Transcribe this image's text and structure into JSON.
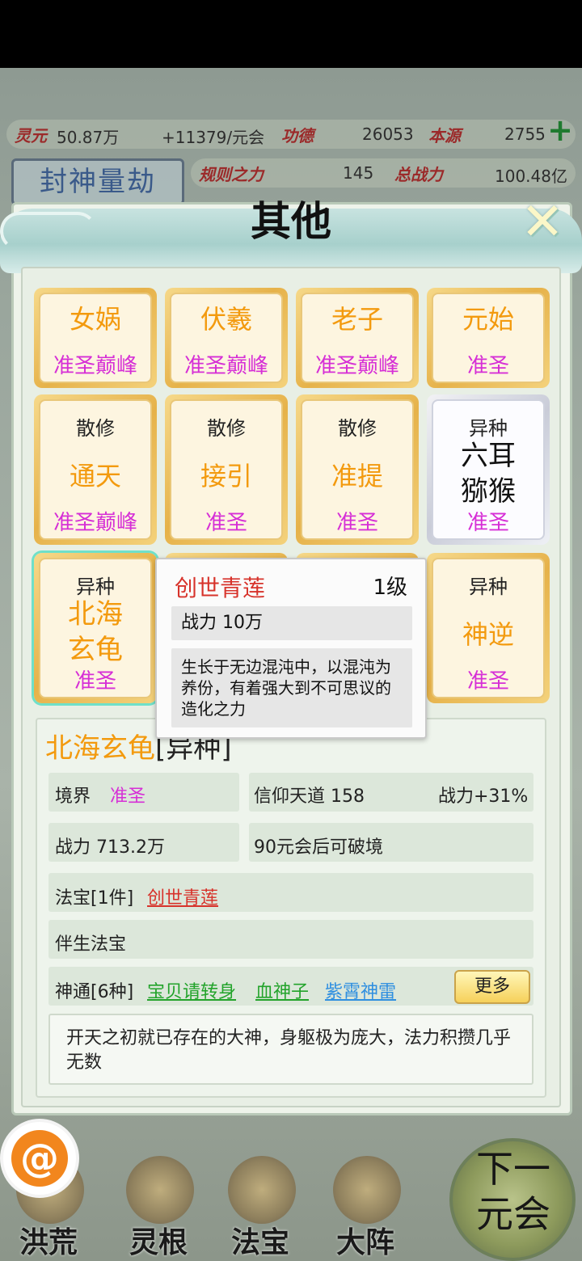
{
  "resources": {
    "lingyuan_label": "灵元",
    "lingyuan_value": "50.87万",
    "lingyuan_rate": "+11379/元会",
    "gongde_label": "功德",
    "gongde_value": "26053",
    "benyuan_label": "本源",
    "benyuan_value": "2755",
    "guize_label": "规则之力",
    "guize_value": "145",
    "zongzhanli_label": "总战力",
    "zongzhanli_value": "100.48亿",
    "event_label": "封神量劫"
  },
  "dialog": {
    "title": "其他",
    "close_symbol": "✕"
  },
  "cards": [
    {
      "type": "",
      "name": "女娲",
      "rank": "准圣巅峰"
    },
    {
      "type": "",
      "name": "伏羲",
      "rank": "准圣巅峰"
    },
    {
      "type": "",
      "name": "老子",
      "rank": "准圣巅峰"
    },
    {
      "type": "",
      "name": "元始",
      "rank": "准圣"
    },
    {
      "type": "散修",
      "name": "通天",
      "rank": "准圣巅峰"
    },
    {
      "type": "散修",
      "name": "接引",
      "rank": "准圣"
    },
    {
      "type": "散修",
      "name": "准提",
      "rank": "准圣"
    },
    {
      "type": "异种",
      "name_line1": "六耳",
      "name_line2": "猕猴",
      "rank": "准圣"
    },
    {
      "type": "异种",
      "name_line1": "北海",
      "name_line2": "玄龟",
      "rank": "准圣"
    },
    {
      "type": "异种",
      "name": "神逆",
      "rank": "准圣"
    }
  ],
  "tooltip": {
    "name": "创世青莲",
    "level": "1级",
    "power": "战力  10万",
    "description": "生长于无边混沌中，以混沌为养份，有着强大到不可思议的造化之力"
  },
  "detail": {
    "name": "北海玄龟",
    "type_suffix": "[异种]",
    "realm_label": "境界",
    "realm_value": "准圣",
    "faith": "信仰天道  158",
    "power_bonus": "战力+31%",
    "power": "战力 713.2万",
    "breakthrough": "90元会后可破境",
    "treasure_label": "法宝[1件]",
    "treasure_item": "创世青莲",
    "companion_label": "伴生法宝",
    "skills_label": "神通[6种]",
    "skill_1": "宝贝请转身",
    "skill_2": "血神子",
    "skill_3": "紫霄神雷",
    "more_button": "更多",
    "description": "开天之初就已存在的大神，身躯极为庞大，法力积攒几乎无数"
  },
  "nav": {
    "items": [
      "洪荒",
      "灵根",
      "法宝",
      "大阵"
    ],
    "next_line1": "下一",
    "next_line2": "元会"
  },
  "colors": {
    "accent_gold": "#f39a0e",
    "rank_pink": "#d62fd6",
    "treasure_red": "#d7332b",
    "skill_green": "#22a32a",
    "skill_blue": "#2f8fe0"
  }
}
